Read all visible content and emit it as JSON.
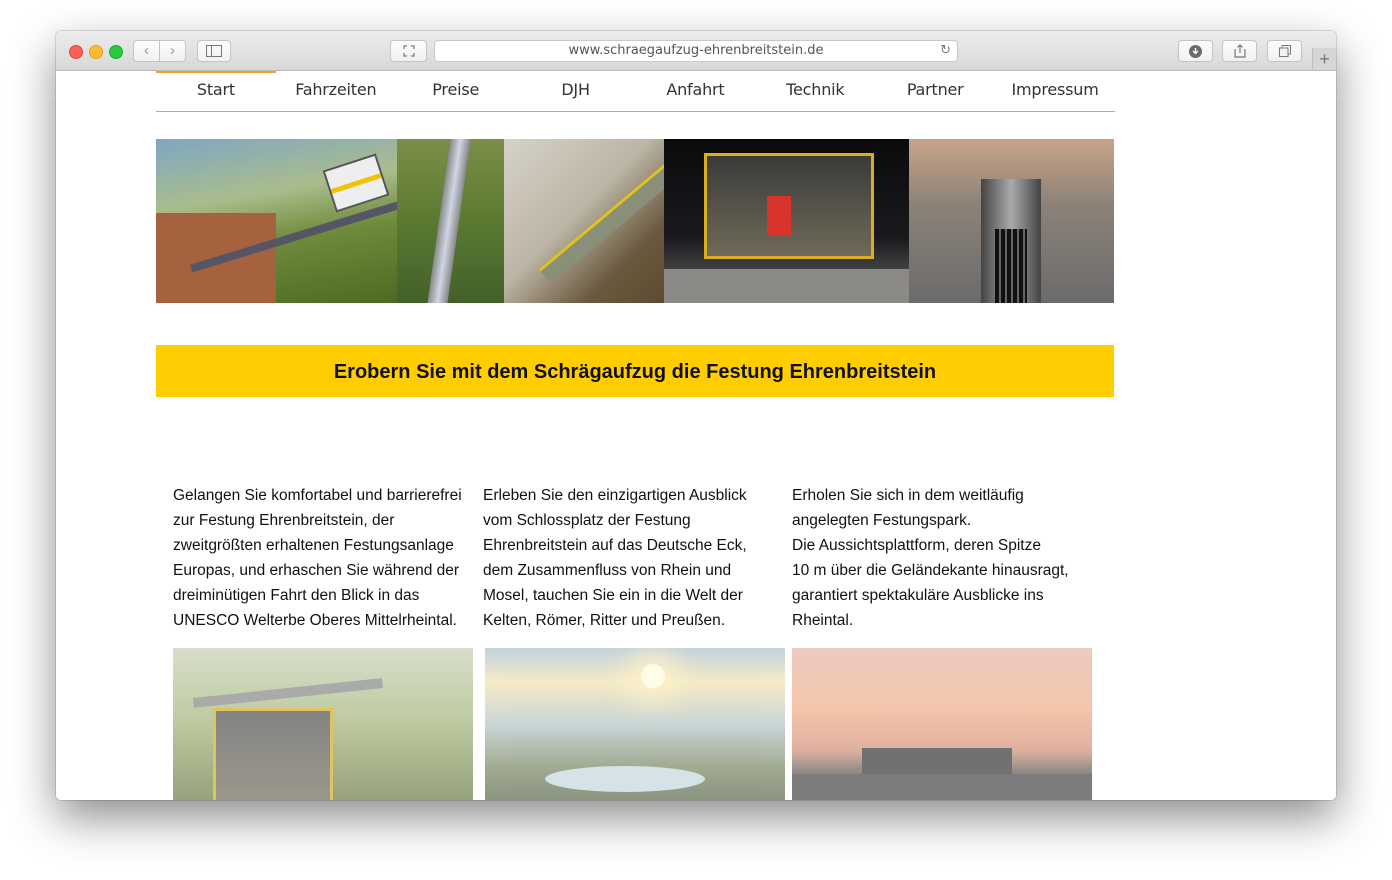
{
  "browser": {
    "url": "www.schraegaufzug-ehrenbreitstein.de",
    "back_glyph": "‹",
    "forward_glyph": "›",
    "reload_glyph": "↻",
    "new_tab_glyph": "+"
  },
  "nav": {
    "items": [
      "Start",
      "Fahrzeiten",
      "Preise",
      "DJH",
      "Anfahrt",
      "Technik",
      "Partner",
      "Impressum"
    ],
    "active": "Start",
    "accent_color": "#f0a71e"
  },
  "headline": {
    "text": "Erobern Sie mit dem Schrägaufzug die Festung Ehrenbreitstein",
    "background": "#ffcd00"
  },
  "columns": [
    {
      "lines": [
        "Gelangen Sie komfortabel und barrierefrei",
        "zur Festung Ehrenbreitstein, der",
        "zweitgrößten erhaltenen Festungsanlage",
        "Europas, und erhaschen Sie während der",
        "dreiminütigen Fahrt den Blick in das",
        "UNESCO Welterbe Oberes Mittelrheintal."
      ]
    },
    {
      "lines": [
        "Erleben Sie den einzigartigen Ausblick",
        "vom Schlossplatz der Festung",
        "Ehrenbreitstein auf das Deutsche Eck,",
        "dem Zusammenfluss von Rhein und",
        "Mosel, tauchen Sie ein in die Welt der",
        "Kelten, Römer, Ritter und Preußen."
      ]
    },
    {
      "lines": [
        "Erholen Sie sich in dem weitläufig",
        "angelegten Festungspark.",
        "Die Aussichtsplattform, deren Spitze",
        "10 m über die Geländekante hinausragt,",
        "garantiert spektakuläre Ausblicke ins",
        "Rheintal."
      ]
    }
  ]
}
